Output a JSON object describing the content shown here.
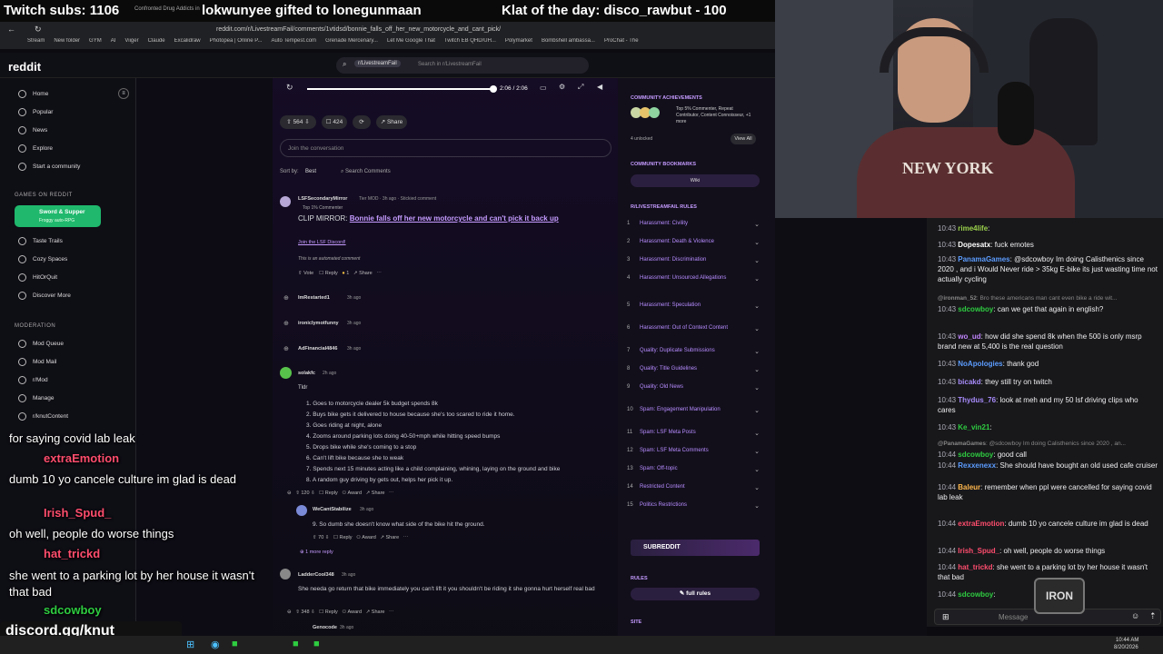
{
  "banner": {
    "subs": "Twitch subs: 1106",
    "small": "Confronted Drug Addicts in",
    "gift": "lokwunyee gifted to lonegunmaan",
    "klat": "Klat of the day: disco_rawbut - 100"
  },
  "browser": {
    "url": "reddit.com/r/LivestreamFail/comments/1vtidsd/bonnie_falls_off_her_new_motorcycle_and_cant_pick/",
    "bookmarks": [
      "Stream",
      "New folder",
      "GYM",
      "AI",
      "Viiger",
      "Claude",
      "Excalidraw",
      "Photopea | Online P...",
      "Auto Tempest.com",
      "Grenade Mercenary...",
      "Let Me Google That",
      "Twitch EB QHD/UH...",
      "Polymarket",
      "Bombshell ambassa...",
      "ProChat - The"
    ]
  },
  "reddit": {
    "logo": "reddit",
    "search_chip": "r/LivestreamFail",
    "search_placeholder": "Search in r/LivestreamFail"
  },
  "video": {
    "time": "2:06 / 2:06"
  },
  "actions": {
    "votes": "564",
    "comments": "424",
    "share": "Share"
  },
  "join": "Join the conversation",
  "sort": {
    "label": "Sort by:",
    "value": "Best",
    "search": "Search Comments"
  },
  "sidebar": {
    "nav": [
      "Home",
      "Popular",
      "News",
      "Explore",
      "Start a community"
    ],
    "games_header": "GAMES ON REDDIT",
    "game_promo": {
      "title": "Sword & Supper",
      "sub": "Froggy auto-RPG"
    },
    "games": [
      "Taste Trails",
      "Cozy Spaces",
      "HitOrQuit",
      "Discover More"
    ],
    "mod_header": "MODERATION",
    "mod": [
      "Mod Queue",
      "Mod Mail",
      "r/Mod",
      "Manage",
      "r/knutContent"
    ]
  },
  "sticky": {
    "user": "LSFSecondaryMirror",
    "meta": "Tier MOD · 3h ago · Stickied comment",
    "badge": "Top 1% Commenter",
    "clip": "CLIP MIRROR:",
    "link": "Bonnie falls off her new motorcycle and can't pick it back up",
    "discord": "Join the LSF Discord!",
    "auto": "This is an automated comment",
    "vote": "Vote",
    "reply": "Reply",
    "share": "Share",
    "count": "1"
  },
  "collapsed": [
    {
      "user": "ImRestarted1",
      "time": "3h ago"
    },
    {
      "user": "ironicIymotfunny",
      "time": "3h ago"
    },
    {
      "user": "AdFinancial4846",
      "time": "3h ago"
    }
  ],
  "solakfc": {
    "user": "solakfc",
    "time": "2h ago",
    "tldr": "Tldr",
    "list": [
      "1. Goes to motorcycle dealer 5k budget spends 8k",
      "2. Buys bike gets it delivered to house because she's too scared to ride it home.",
      "3. Goes riding at night, alone",
      "4. Zooms around parking lots doing 40-50+mph while hitting speed bumps",
      "5. Drops bike while she's coming to a stop",
      "6. Can't lift bike because she to weak",
      "7. Spends next 15 minutes acting like a child complaining, whining, laying on the ground and bike",
      "8. A random guy driving by gets out, helps her pick it up."
    ],
    "score": "120",
    "reply": "Reply",
    "award": "Award",
    "share": "Share"
  },
  "wecant": {
    "user": "WeCantStabilize",
    "time": "3h ago",
    "text": "9. So dumb she doesn't know what side of the bike hit the ground.",
    "score": "70",
    "reply": "Reply",
    "award": "Award",
    "share": "Share",
    "more": "1 more reply"
  },
  "ladder": {
    "user": "LadderCool348",
    "time": "3h ago",
    "text": "She needa go return that bike immediately you can't lift it you shouldn't be riding it she gonna hurt herself real bad",
    "score": "348",
    "reply": "Reply",
    "award": "Award",
    "share": "Share"
  },
  "genocode": {
    "user": "Genocode",
    "time": "3h ago"
  },
  "right": {
    "ach_title": "COMMUNITY ACHIEVEMENTS",
    "ach_text": "Top 5% Commenter, Repeat Contributor, Content Connoisseur, +1 more",
    "unlocked": "4 unlocked",
    "view_all": "View All",
    "bm_title": "COMMUNITY BOOKMARKS",
    "wiki": "Wiki",
    "rules_title": "R/LIVESTREAMFAIL RULES",
    "rules": [
      "Harassment: Civility",
      "Harassment: Death & Violence",
      "Harassment: Discrimination",
      "Harassment: Unsourced Allegations",
      "Harassment: Speculation",
      "Harassment: Out of Context Content",
      "Quality: Duplicate Submissions",
      "Quality: Title Guidelines",
      "Quality: Old News",
      "Spam: Engagement Manipulation",
      "Spam: LSF Meta Posts",
      "Spam: LSF Meta Comments",
      "Spam: Off-topic",
      "Restricted Content",
      "Politics Restrictions"
    ],
    "subreddit_btn": "SUBREDDIT",
    "rules_label": "RULES",
    "full_rules": "full rules",
    "site": "SITE"
  },
  "chat": [
    {
      "t": "10:43",
      "u": "rime4life",
      "c": "#9bd14b",
      "m": ""
    },
    {
      "t": "10:43",
      "u": "Dopesatx",
      "c": "#ffffff",
      "m": "fuck emotes"
    },
    {
      "t": "10:43",
      "u": "PanamaGames",
      "c": "#5c9dff",
      "m": "@sdcowboy Im doing Calisthenics since 2020 , and i Would Never ride > 35kg E-bike its just wasting time not actually cycling"
    },
    {
      "t": "",
      "u": "@ironman_52",
      "c": "#888888",
      "m": "Bro these americans man cant even bike a ride wit..."
    },
    {
      "t": "10:43",
      "u": "sdcowboy",
      "c": "#2ecc40",
      "m": "can we get that again in english?"
    },
    {
      "t": "10:43",
      "u": "wo_ud",
      "c": "#c084fc",
      "m": "how did she spend 8k when the 500 is only msrp brand new at 5,400 is the real question"
    },
    {
      "t": "10:43",
      "u": "NoApologies",
      "c": "#5c9dff",
      "m": "thank god"
    },
    {
      "t": "10:43",
      "u": "bicakd",
      "c": "#a78bfa",
      "m": "they still try on twitch"
    },
    {
      "t": "10:43",
      "u": "Thydus_76",
      "c": "#a78bfa",
      "m": "look at meh and my 50 lsf driving clips who cares"
    },
    {
      "t": "10:43",
      "u": "Ke_vin21",
      "c": "#2ecc40",
      "m": ""
    },
    {
      "t": "",
      "u": "@PanamaGames",
      "c": "#888888",
      "m": "@sdcowboy Im doing Calisthenics since 2020 , an..."
    },
    {
      "t": "10:44",
      "u": "sdcowboy",
      "c": "#2ecc40",
      "m": "good call"
    },
    {
      "t": "10:44",
      "u": "Rexxenexx",
      "c": "#5c9dff",
      "m": "She should have bought an old used cafe cruiser"
    },
    {
      "t": "10:44",
      "u": "Baleur",
      "c": "#ffb84d",
      "m": "remember when ppl were cancelled for saying covid lab leak"
    },
    {
      "t": "10:44",
      "u": "extraEmotion",
      "c": "#ff4d6d",
      "m": "dumb 10 yo cancele culture im glad is dead"
    },
    {
      "t": "10:44",
      "u": "Irish_Spud_",
      "c": "#ff4d6d",
      "m": "oh well, people do worse things"
    },
    {
      "t": "10:44",
      "u": "hat_trickd",
      "c": "#ff4d6d",
      "m": "she went to a parking lot by her house it wasn't that bad"
    },
    {
      "t": "10:44",
      "u": "sdcowboy",
      "c": "#2ecc40",
      "m": ""
    }
  ],
  "chat_input": "Message",
  "overlay": {
    "l1": "for saying covid lab leak",
    "u1": "extraEmotion",
    "l2": "dumb 10 yo cancele culture im glad is dead",
    "u2": "Irish_Spud_",
    "l3": "oh well, people do worse things",
    "u3": "hat_trickd",
    "l4": "she went to a parking lot by her house it wasn't that bad",
    "u4": "sdcowboy",
    "discord": "discord.gg/knut"
  },
  "clock": {
    "time": "10:44 AM",
    "date": "8/20/2026"
  },
  "shirt": "NEW YORK"
}
